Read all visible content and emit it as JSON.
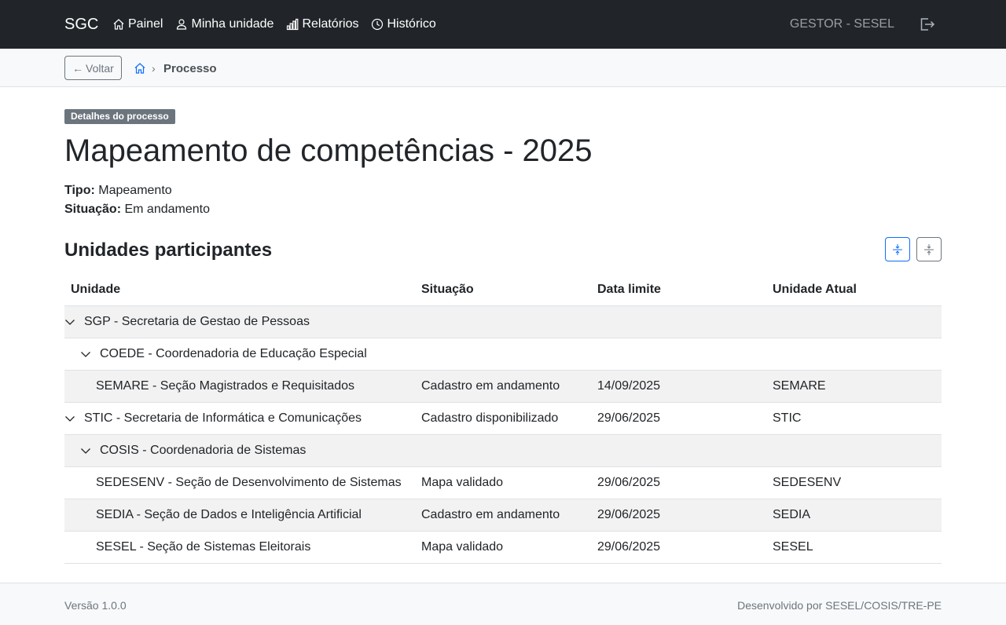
{
  "navbar": {
    "brand": "SGC",
    "links": [
      {
        "label": "Painel",
        "icon": "house-icon"
      },
      {
        "label": "Minha unidade",
        "icon": "person-icon"
      },
      {
        "label": "Relatórios",
        "icon": "bar-chart-icon"
      },
      {
        "label": "Histórico",
        "icon": "clock-icon"
      }
    ],
    "user": "GESTOR - SESEL",
    "logout_icon": "logout-icon"
  },
  "breadcrumb": {
    "back_label": "Voltar",
    "current": "Processo"
  },
  "process": {
    "badge": "Detalhes do processo",
    "title": "Mapeamento de competências - 2025",
    "tipo_label": "Tipo:",
    "tipo_value": "Mapeamento",
    "situacao_label": "Situação:",
    "situacao_value": "Em andamento"
  },
  "units": {
    "section_title": "Unidades participantes",
    "columns": [
      "Unidade",
      "Situação",
      "Data limite",
      "Unidade Atual"
    ],
    "rows": [
      {
        "level": 0,
        "expandable": true,
        "shade": true,
        "unidade": "SGP - Secretaria de Gestao de Pessoas",
        "situacao": "",
        "data_limite": "",
        "unidade_atual": ""
      },
      {
        "level": 1,
        "expandable": true,
        "shade": false,
        "unidade": "COEDE - Coordenadoria de Educação Especial",
        "situacao": "",
        "data_limite": "",
        "unidade_atual": ""
      },
      {
        "level": 2,
        "expandable": false,
        "shade": true,
        "unidade": "SEMARE - Seção Magistrados e Requisitados",
        "situacao": "Cadastro em andamento",
        "data_limite": "14/09/2025",
        "unidade_atual": "SEMARE"
      },
      {
        "level": 0,
        "expandable": true,
        "shade": false,
        "unidade": "STIC - Secretaria de Informática e Comunicações",
        "situacao": "Cadastro disponibilizado",
        "data_limite": "29/06/2025",
        "unidade_atual": "STIC"
      },
      {
        "level": 1,
        "expandable": true,
        "shade": true,
        "unidade": "COSIS - Coordenadoria de Sistemas",
        "situacao": "",
        "data_limite": "",
        "unidade_atual": ""
      },
      {
        "level": 2,
        "expandable": false,
        "shade": false,
        "unidade": "SEDESENV - Seção de Desenvolvimento de Sistemas",
        "situacao": "Mapa validado",
        "data_limite": "29/06/2025",
        "unidade_atual": "SEDESENV"
      },
      {
        "level": 2,
        "expandable": false,
        "shade": true,
        "unidade": "SEDIA - Seção de Dados e Inteligência Artificial",
        "situacao": "Cadastro em andamento",
        "data_limite": "29/06/2025",
        "unidade_atual": "SEDIA"
      },
      {
        "level": 2,
        "expandable": false,
        "shade": false,
        "unidade": "SESEL - Seção de Sistemas Eleitorais",
        "situacao": "Mapa validado",
        "data_limite": "29/06/2025",
        "unidade_atual": "SESEL"
      }
    ]
  },
  "footer": {
    "version": "Versão 1.0.0",
    "credits": "Desenvolvido por SESEL/COSIS/TRE-PE"
  }
}
